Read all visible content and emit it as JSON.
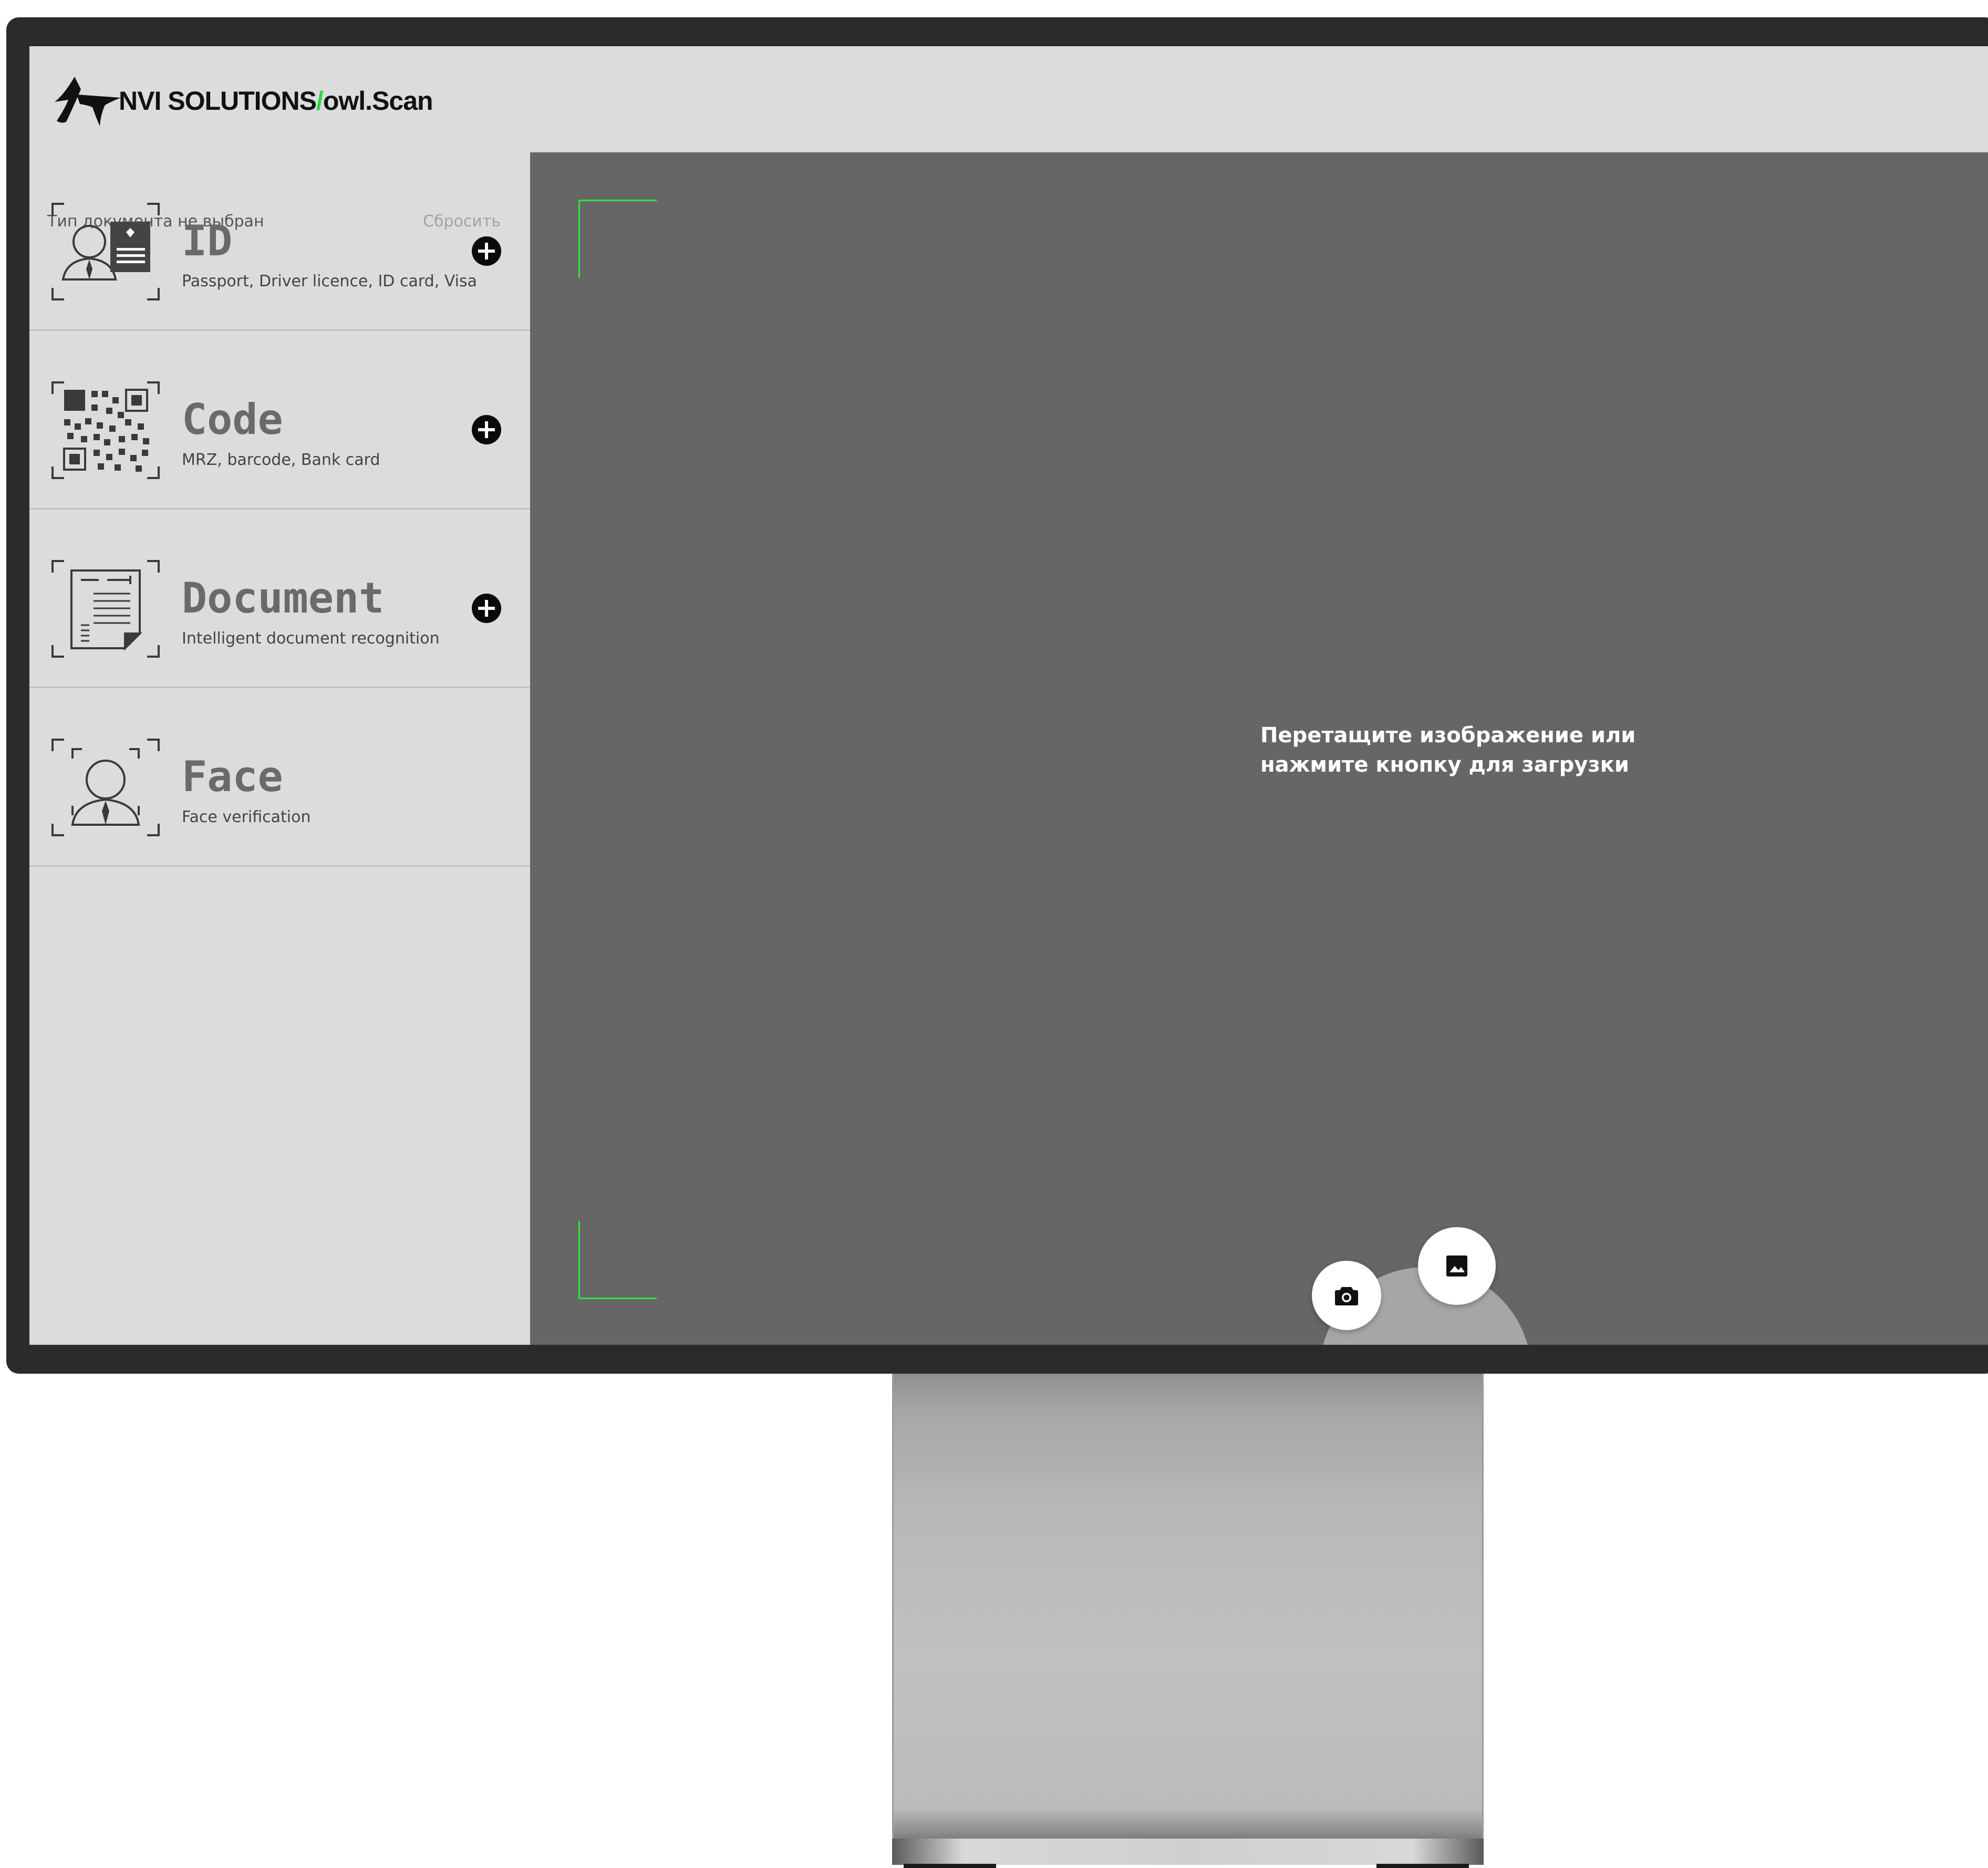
{
  "brand": {
    "name": "NVI SOLUTIONS",
    "slash": "/",
    "product": "owl.Scan",
    "accent_color": "#2bd93c"
  },
  "sidebar": {
    "status": "Тип документа не выбран",
    "reset_label": "Сбросить",
    "items": [
      {
        "title": "ID",
        "subtitle": "Passport, Driver licence, ID card, Visa",
        "icon": "id-card-icon",
        "has_add": true
      },
      {
        "title": "Code",
        "subtitle": "MRZ, barcode, Bank card",
        "icon": "qr-code-icon",
        "has_add": true
      },
      {
        "title": "Document",
        "subtitle": "Intelligent document recognition",
        "icon": "document-icon",
        "has_add": true
      },
      {
        "title": "Face",
        "subtitle": "Face verification",
        "icon": "face-icon",
        "has_add": false
      }
    ]
  },
  "main": {
    "hint_line1": "Перетащите изображение или",
    "hint_line2": "нажмите кнопку для загрузки",
    "frame_color": "#2ee63a",
    "camera_icon": "camera-icon",
    "gallery_icon": "image-icon"
  }
}
